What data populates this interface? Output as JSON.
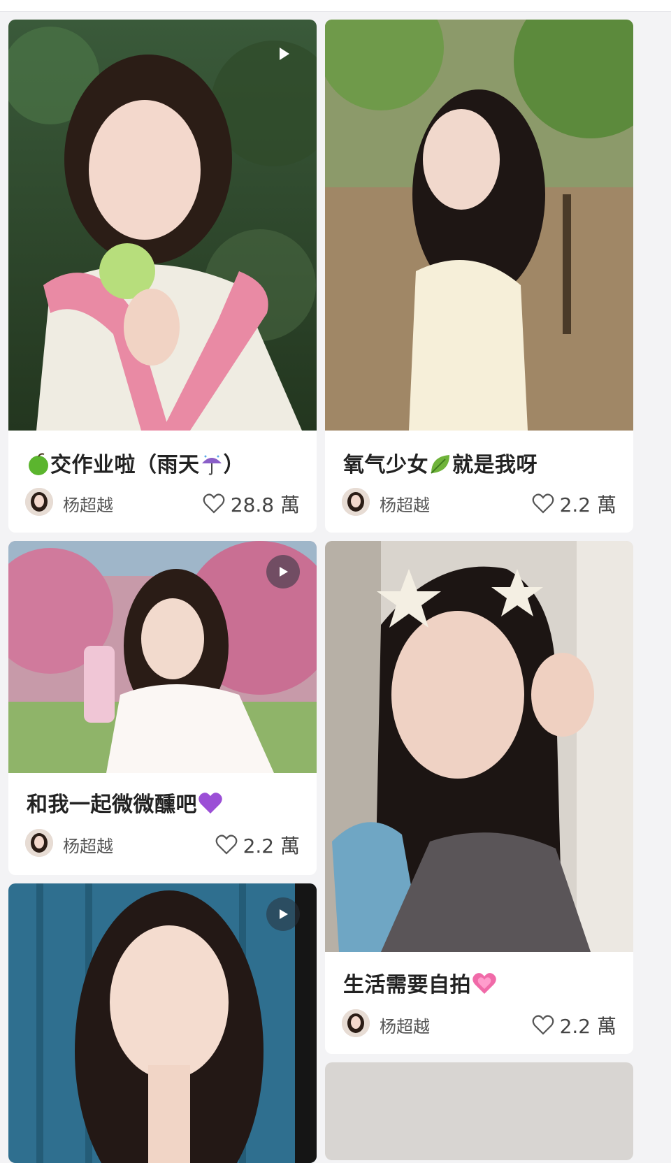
{
  "feed": {
    "cards": [
      {
        "title_text": "交作业啦（雨天",
        "title_close": "）",
        "title_emoji_lead": "green-apple",
        "title_emoji_trail": "umbrella-rain",
        "author": "杨超越",
        "likes": "28.8 萬",
        "media_type": "video-indicator-plain",
        "photo": "woman-with-apple-pink-scarf"
      },
      {
        "title_text": "氧气少女",
        "title_text_2": "就是我呀",
        "title_emoji_mid": "leaf",
        "author": "杨超越",
        "likes": "2.2 萬",
        "photo": "woman-in-park-white-dress"
      },
      {
        "title_text": "和我一起微微醺吧",
        "title_emoji_trail": "purple-heart",
        "author": "杨超越",
        "likes": "2.2 萬",
        "media_type": "video-indicator-circle",
        "photo": "woman-with-can-pink-blossoms"
      },
      {
        "title_text": "生活需要自拍",
        "title_emoji_trail": "sparkling-heart",
        "author": "杨超越",
        "likes": "2.2 萬",
        "photo": "selfie-with-star-hairclips"
      },
      {
        "media_type": "video-indicator-circle",
        "photo": "portrait-blue-curtain"
      }
    ]
  },
  "colors": {
    "background": "#f3f3f5",
    "card": "#ffffff",
    "title_text": "#222222",
    "meta_text": "#555555"
  }
}
